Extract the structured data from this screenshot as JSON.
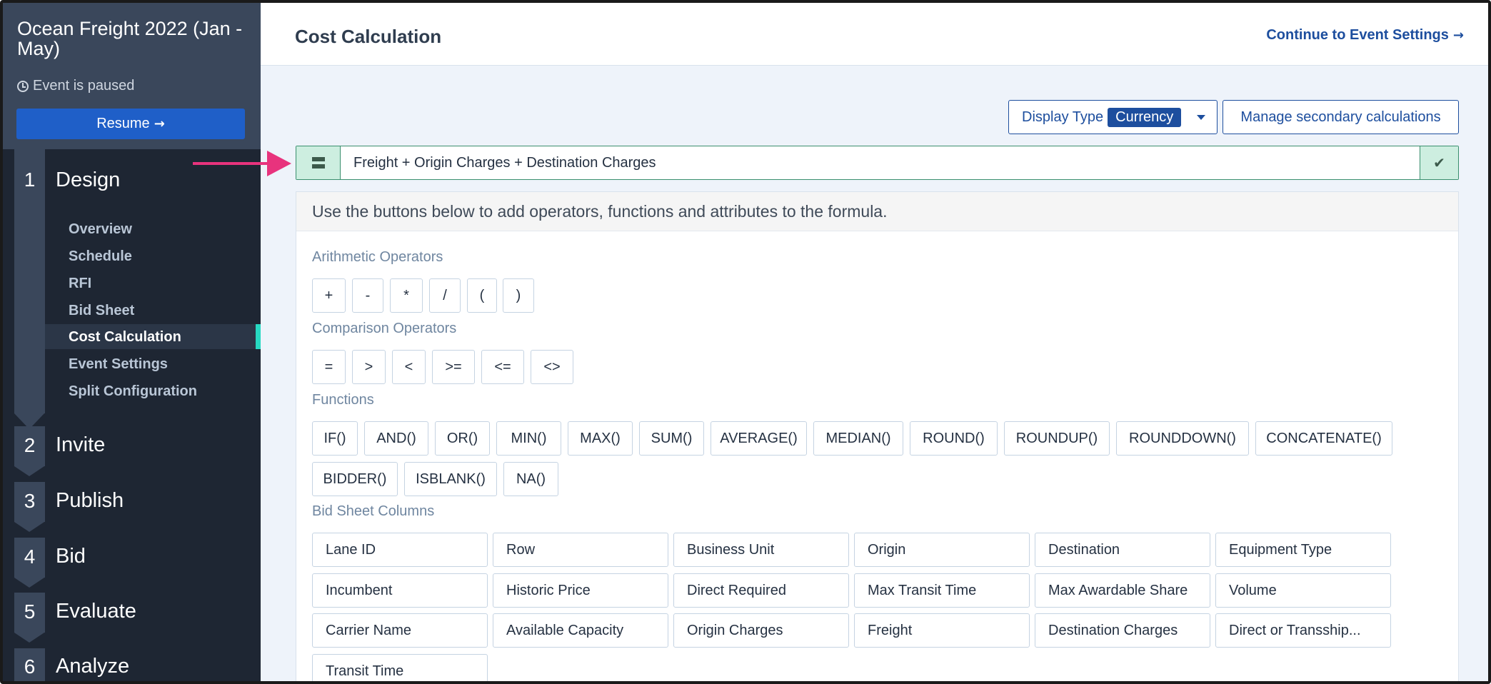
{
  "sidebar": {
    "event_title": "Ocean Freight 2022 (Jan - May)",
    "status": "Event is paused",
    "resume_label": "Resume",
    "steps": [
      {
        "num": "1",
        "label": "Design"
      },
      {
        "num": "2",
        "label": "Invite"
      },
      {
        "num": "3",
        "label": "Publish"
      },
      {
        "num": "4",
        "label": "Bid"
      },
      {
        "num": "5",
        "label": "Evaluate"
      },
      {
        "num": "6",
        "label": "Analyze"
      }
    ],
    "design_items": [
      {
        "label": "Overview"
      },
      {
        "label": "Schedule"
      },
      {
        "label": "RFI"
      },
      {
        "label": "Bid Sheet"
      },
      {
        "label": "Cost Calculation"
      },
      {
        "label": "Event Settings"
      },
      {
        "label": "Split Configuration"
      }
    ]
  },
  "header": {
    "title": "Cost Calculation",
    "continue_label": "Continue to Event Settings"
  },
  "toolbar": {
    "display_type_label": "Display Type",
    "display_type_value": "Currency",
    "manage_label": "Manage secondary calculations"
  },
  "formula": {
    "value": "Freight + Origin Charges + Destination Charges"
  },
  "panel": {
    "instructions": "Use the buttons below to add operators, functions and attributes to the formula.",
    "arithmetic_label": "Arithmetic Operators",
    "arithmetic": [
      "+",
      "-",
      "*",
      "/",
      "(",
      ")"
    ],
    "comparison_label": "Comparison Operators",
    "comparison": [
      "=",
      ">",
      "<",
      ">=",
      "<=",
      "<>"
    ],
    "functions_label": "Functions",
    "functions": [
      "IF()",
      "AND()",
      "OR()",
      "MIN()",
      "MAX()",
      "SUM()",
      "AVERAGE()",
      "MEDIAN()",
      "ROUND()",
      "ROUNDUP()",
      "ROUNDDOWN()",
      "CONCATENATE()",
      "BIDDER()",
      "ISBLANK()",
      "NA()"
    ],
    "columns_label": "Bid Sheet Columns",
    "columns": [
      "Lane ID",
      "Row",
      "Business Unit",
      "Origin",
      "Destination",
      "Equipment Type",
      "Incumbent",
      "Historic Price",
      "Direct Required",
      "Max Transit Time",
      "Max Awardable Share",
      "Volume",
      "Carrier Name",
      "Available Capacity",
      "Origin Charges",
      "Freight",
      "Destination Charges",
      "Direct or Transship...",
      "Transit Time"
    ]
  },
  "colors": {
    "sidebar_bg": "#1e2633",
    "sidebar_head": "#3a475b",
    "accent_blue": "#1d4e9e",
    "resume_blue": "#1f5fc8",
    "active_marker": "#27d9c2",
    "formula_green": "#cdeee0",
    "pointer_pink": "#e8337d"
  }
}
